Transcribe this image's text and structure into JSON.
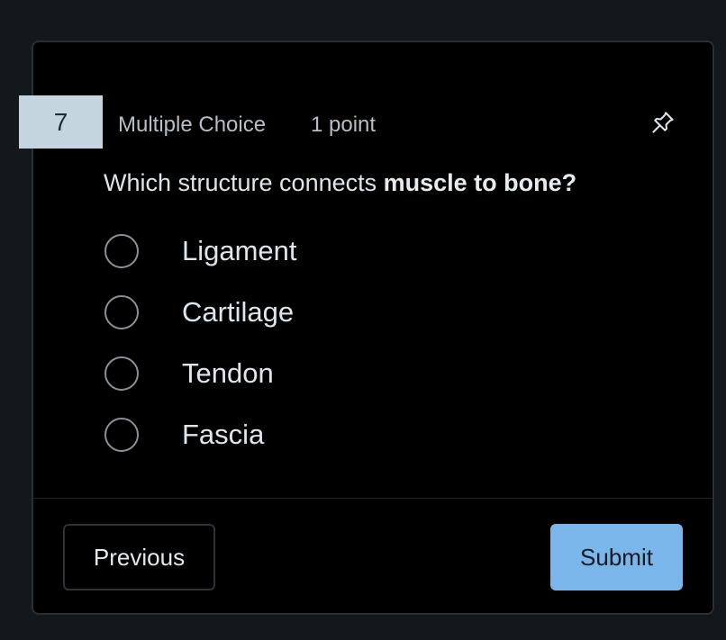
{
  "question": {
    "number": "7",
    "type": "Multiple Choice",
    "points": "1 point",
    "text_before": "Which structure connects ",
    "text_bold": "muscle to bone?",
    "options": [
      {
        "label": "Ligament"
      },
      {
        "label": "Cartilage"
      },
      {
        "label": "Tendon"
      },
      {
        "label": "Fascia"
      }
    ]
  },
  "icons": {
    "pin": "pin-icon"
  },
  "footer": {
    "previous_label": "Previous",
    "submit_label": "Submit"
  },
  "colors": {
    "background": "#13181d",
    "card": "#000000",
    "question_number_bg": "#c5d5df",
    "submit_bg": "#7ab6e9"
  }
}
